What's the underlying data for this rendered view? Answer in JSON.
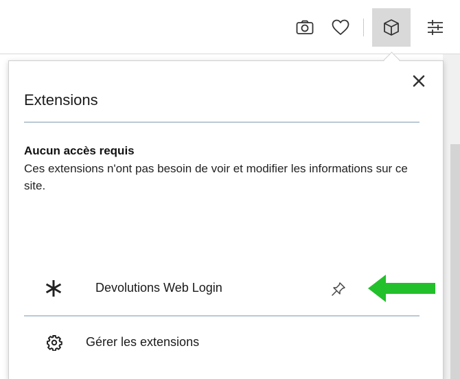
{
  "popup": {
    "title": "Extensions",
    "close_icon": "close-icon",
    "section": {
      "heading": "Aucun accès requis",
      "description": "Ces extensions n'ont pas besoin de voir et modifier les informations sur ce site."
    },
    "extension": {
      "name": "Devolutions Web Login",
      "icon": "asterisk-icon",
      "pin_icon": "pin-icon"
    },
    "manage": {
      "label": "Gérer les extensions",
      "icon": "gear-icon"
    }
  },
  "toolbar": {
    "icons": [
      "camera-icon",
      "heart-icon",
      "cube-icon",
      "sliders-icon"
    ],
    "active": "cube-icon"
  },
  "colors": {
    "divider": "#b9c9d4",
    "arrow": "#22c02a",
    "active_button": "#d9d9d9"
  }
}
